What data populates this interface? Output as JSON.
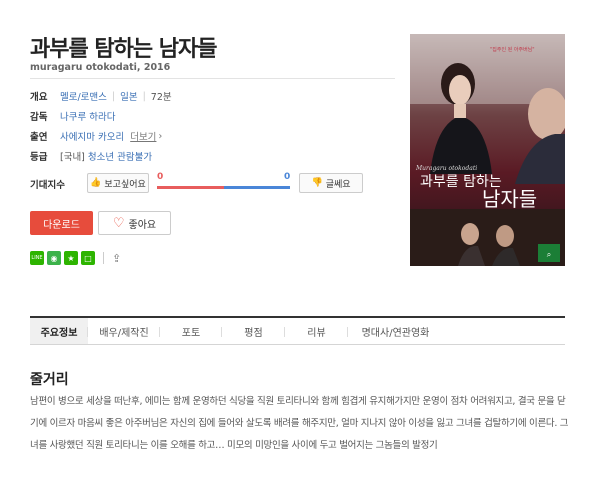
{
  "movie": {
    "title": "과부를 탐하는 남자들",
    "original": "muragaru otokodati, 2016"
  },
  "info": {
    "overview_label": "개요",
    "genre": "멜로/로맨스",
    "country": "일본",
    "runtime": "72분",
    "director_label": "감독",
    "director": "나쿠루 하라다",
    "cast_label": "출연",
    "cast": "사에지마 카오리",
    "more": "더보기",
    "rating_label": "등급",
    "rating_prefix": "[국내]",
    "rating": "청소년 관람불가"
  },
  "expect": {
    "label": "기대지수",
    "want_label": "보고싶어요",
    "want_count": "0",
    "nowant_label": "글쎄요",
    "nowant_count": "0",
    "want_ratio": 0.5
  },
  "actions": {
    "download": "다운로드",
    "like": "좋아요"
  },
  "share": {
    "icons": [
      "line-icon",
      "band-icon",
      "star-icon",
      "square-icon",
      "share-icon"
    ],
    "line_text": "LINE"
  },
  "poster": {
    "tagline": "\"집주인 된 아주버님\"",
    "en_title": "Muragaru otokodati",
    "title_line1": "과부를 탐하는",
    "title_line2": "남자들"
  },
  "tabs": [
    "주요정보",
    "배우/제작진",
    "포토",
    "평점",
    "리뷰",
    "명대사/연관영화"
  ],
  "synopsis": {
    "heading": "줄거리",
    "text": "남편이 병으로 세상을 떠난후, 에미는 함께 운영하던 식당을 직원 토리타니와 함께 힘겹게 유지해가지만 운영이 점차 어려워지고, 결국 문을 닫기에 이르자 마음씨 좋은 아주버님은 자신의 집에 들어와 살도록 배려를 해주지만, 얼마 지나지 않아 이성을 잃고 그녀를 겁탈하기에 이른다. 그녀를 사랑했던 직원 토리타니는 이를 오해를 하고… 미모의 미망인을 사이에 두고 벌어지는 그놈들의 발정기"
  },
  "colors": {
    "accent_red": "#e74c3c",
    "link_blue": "#3a6fb4",
    "want_red": "#e85d5d",
    "nowant_blue": "#4a86d8",
    "green": "#2db400"
  }
}
